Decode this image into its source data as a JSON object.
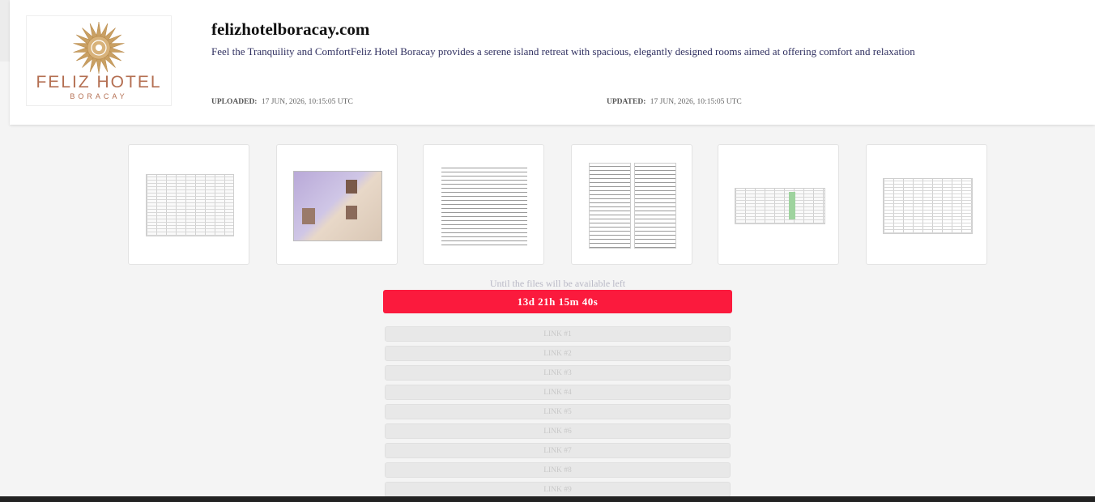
{
  "header": {
    "logo": {
      "main": "FELIZ HOTEL",
      "sub": "BORACAY",
      "color": "#b46f52"
    },
    "title": "felizhotelboracay.com",
    "description": "Feel the Tranquility and ComfortFeliz Hotel Boracay provides a serene island retreat with spacious, elegantly designed rooms aimed at offering comfort and relaxation",
    "uploaded_label": "UPLOADED:",
    "uploaded_value": "17 JUN, 2026, 10:15:05 UTC",
    "updated_label": "UPDATED:",
    "updated_value": "17 JUN, 2026, 10:15:05 UTC"
  },
  "thumbnails": [
    "spreadsheet",
    "passport-scan",
    "document-scan",
    "receipt-scan",
    "spreadsheet",
    "financial-table"
  ],
  "countdown": {
    "label": "Until the files will be available left",
    "value": "13d 21h 15m 40s",
    "color": "#fb1a3d"
  },
  "links": [
    "LINK #1",
    "LINK #2",
    "LINK #3",
    "LINK #4",
    "LINK #5",
    "LINK #6",
    "LINK #7",
    "LINK #8",
    "LINK #9"
  ]
}
